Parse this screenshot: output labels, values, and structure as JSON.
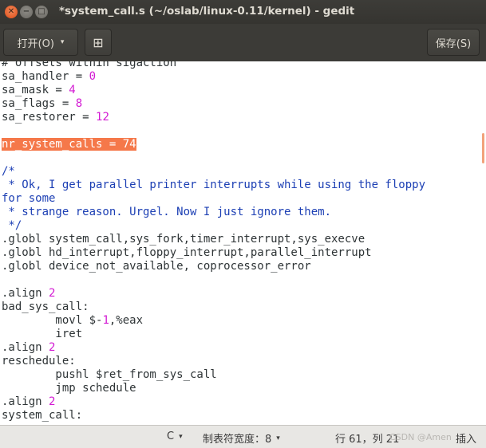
{
  "window": {
    "title": "*system_call.s (~/oslab/linux-0.11/kernel) - gedit",
    "close_glyph": "✕",
    "min_glyph": "−",
    "max_glyph": "□"
  },
  "toolbar": {
    "open_label": "打开(O)",
    "open_caret": "▾",
    "new_tab_glyph": "⊞",
    "save_label": "保存(S)"
  },
  "editor": {
    "selection_color": "#f5784a",
    "number_color": "#d31ad3",
    "comment_color": "#1c3fb4",
    "lines": [
      [
        {
          "t": "# offsets within sigaction"
        }
      ],
      [
        {
          "t": "sa_handler = "
        },
        {
          "t": "0",
          "c": "num"
        }
      ],
      [
        {
          "t": "sa_mask = "
        },
        {
          "t": "4",
          "c": "num"
        }
      ],
      [
        {
          "t": "sa_flags = "
        },
        {
          "t": "8",
          "c": "num"
        }
      ],
      [
        {
          "t": "sa_restorer = "
        },
        {
          "t": "12",
          "c": "num"
        }
      ],
      [],
      [
        {
          "t": "nr_system_calls = 74",
          "c": "sel"
        }
      ],
      [],
      [
        {
          "t": "/*",
          "c": "comment"
        }
      ],
      [
        {
          "t": " * Ok, I get parallel printer interrupts while using the floppy",
          "c": "comment"
        }
      ],
      [
        {
          "t": "for some",
          "c": "comment"
        }
      ],
      [
        {
          "t": " * strange reason. Urgel. Now I just ignore them.",
          "c": "comment"
        }
      ],
      [
        {
          "t": " */",
          "c": "comment"
        }
      ],
      [
        {
          "t": ".globl system_call,sys_fork,timer_interrupt,sys_execve"
        }
      ],
      [
        {
          "t": ".globl hd_interrupt,floppy_interrupt,parallel_interrupt"
        }
      ],
      [
        {
          "t": ".globl device_not_available, coprocessor_error"
        }
      ],
      [],
      [
        {
          "t": ".align "
        },
        {
          "t": "2",
          "c": "num"
        }
      ],
      [
        {
          "t": "bad_sys_call:"
        }
      ],
      [
        {
          "t": "        movl $-"
        },
        {
          "t": "1",
          "c": "num"
        },
        {
          "t": ",%eax"
        }
      ],
      [
        {
          "t": "        iret"
        }
      ],
      [
        {
          "t": ".align "
        },
        {
          "t": "2",
          "c": "num"
        }
      ],
      [
        {
          "t": "reschedule:"
        }
      ],
      [
        {
          "t": "        pushl $ret_from_sys_call"
        }
      ],
      [
        {
          "t": "        jmp schedule"
        }
      ],
      [
        {
          "t": ".align "
        },
        {
          "t": "2",
          "c": "num"
        }
      ],
      [
        {
          "t": "system_call:"
        }
      ]
    ]
  },
  "statusbar": {
    "language": "C",
    "tab_width": "制表符宽度：8",
    "caret": "▾",
    "position": "行 61，列 21",
    "mode": "插入",
    "watermark": "CSDN @Amen"
  }
}
